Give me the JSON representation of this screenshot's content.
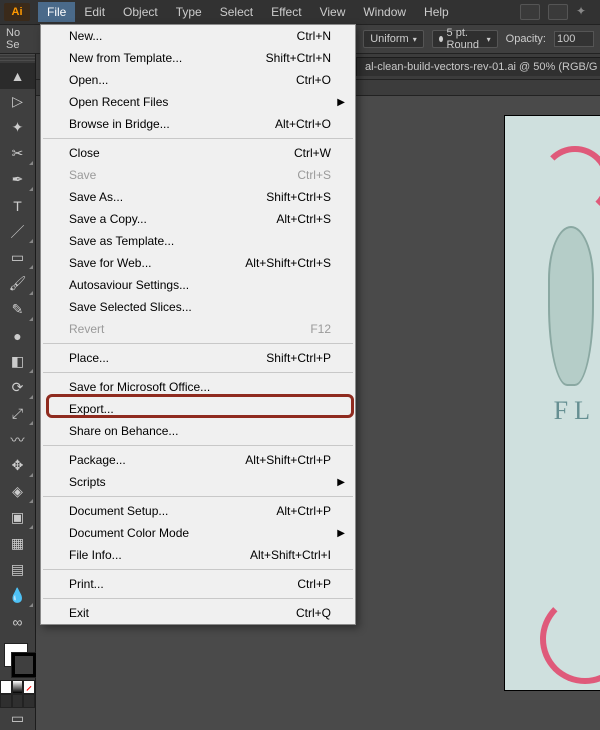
{
  "app": {
    "badge": "Ai"
  },
  "menubar": {
    "items": [
      "File",
      "Edit",
      "Object",
      "Type",
      "Select",
      "Effect",
      "View",
      "Window",
      "Help"
    ],
    "active_index": 0
  },
  "optionsbar": {
    "no_selection": "No Se",
    "stroke_style": "Uniform",
    "stroke_weight": "5 pt. Round",
    "opacity_label": "Opacity:",
    "opacity_value": "100"
  },
  "document": {
    "tab_title": "al-clean-build-vectors-rev-01.ai @ 50% (RGB/G",
    "artboard_text": "FL"
  },
  "toolbar": {
    "tools": [
      "selection",
      "direct-selection",
      "magic-wand",
      "lasso",
      "pen",
      "type",
      "line",
      "rectangle",
      "paintbrush",
      "pencil",
      "blob-brush",
      "eraser",
      "rotate",
      "scale",
      "width",
      "free-transform",
      "shape-builder",
      "perspective",
      "mesh",
      "gradient",
      "eyedropper",
      "blend",
      "symbol-sprayer",
      "column-graph",
      "artboard",
      "slice",
      "hand",
      "zoom"
    ]
  },
  "file_menu": {
    "groups": [
      [
        {
          "label": "New...",
          "shortcut": "Ctrl+N",
          "enabled": true,
          "submenu": false
        },
        {
          "label": "New from Template...",
          "shortcut": "Shift+Ctrl+N",
          "enabled": true,
          "submenu": false
        },
        {
          "label": "Open...",
          "shortcut": "Ctrl+O",
          "enabled": true,
          "submenu": false
        },
        {
          "label": "Open Recent Files",
          "shortcut": "",
          "enabled": true,
          "submenu": true
        },
        {
          "label": "Browse in Bridge...",
          "shortcut": "Alt+Ctrl+O",
          "enabled": true,
          "submenu": false
        }
      ],
      [
        {
          "label": "Close",
          "shortcut": "Ctrl+W",
          "enabled": true,
          "submenu": false
        },
        {
          "label": "Save",
          "shortcut": "Ctrl+S",
          "enabled": false,
          "submenu": false
        },
        {
          "label": "Save As...",
          "shortcut": "Shift+Ctrl+S",
          "enabled": true,
          "submenu": false
        },
        {
          "label": "Save a Copy...",
          "shortcut": "Alt+Ctrl+S",
          "enabled": true,
          "submenu": false
        },
        {
          "label": "Save as Template...",
          "shortcut": "",
          "enabled": true,
          "submenu": false
        },
        {
          "label": "Save for Web...",
          "shortcut": "Alt+Shift+Ctrl+S",
          "enabled": true,
          "submenu": false
        },
        {
          "label": "Autosaviour Settings...",
          "shortcut": "",
          "enabled": true,
          "submenu": false
        },
        {
          "label": "Save Selected Slices...",
          "shortcut": "",
          "enabled": true,
          "submenu": false
        },
        {
          "label": "Revert",
          "shortcut": "F12",
          "enabled": false,
          "submenu": false
        }
      ],
      [
        {
          "label": "Place...",
          "shortcut": "Shift+Ctrl+P",
          "enabled": true,
          "submenu": false
        }
      ],
      [
        {
          "label": "Save for Microsoft Office...",
          "shortcut": "",
          "enabled": true,
          "submenu": false
        },
        {
          "label": "Export...",
          "shortcut": "",
          "enabled": true,
          "submenu": false
        },
        {
          "label": "Share on Behance...",
          "shortcut": "",
          "enabled": true,
          "submenu": false
        }
      ],
      [
        {
          "label": "Package...",
          "shortcut": "Alt+Shift+Ctrl+P",
          "enabled": true,
          "submenu": false
        },
        {
          "label": "Scripts",
          "shortcut": "",
          "enabled": true,
          "submenu": true
        }
      ],
      [
        {
          "label": "Document Setup...",
          "shortcut": "Alt+Ctrl+P",
          "enabled": true,
          "submenu": false
        },
        {
          "label": "Document Color Mode",
          "shortcut": "",
          "enabled": true,
          "submenu": true
        },
        {
          "label": "File Info...",
          "shortcut": "Alt+Shift+Ctrl+I",
          "enabled": true,
          "submenu": false
        }
      ],
      [
        {
          "label": "Print...",
          "shortcut": "Ctrl+P",
          "enabled": true,
          "submenu": false
        }
      ],
      [
        {
          "label": "Exit",
          "shortcut": "Ctrl+Q",
          "enabled": true,
          "submenu": false
        }
      ]
    ],
    "highlighted_label": "Export..."
  }
}
